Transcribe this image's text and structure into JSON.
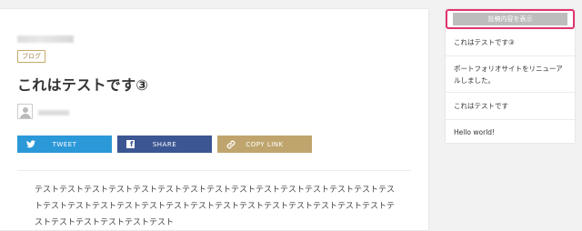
{
  "post": {
    "category": "ブログ",
    "title": "これはテストです③",
    "share": {
      "tweet_label": "TWEET",
      "share_label": "SHARE",
      "copy_label": "COPY LINK"
    },
    "body": "テストテストテストテストテストテストテストテストテストテストテストテストテストテストテストテストテストテストテストテストテストテストテストテストテストテストテストテストテストテストテストテストテストテストテスト"
  },
  "sidebar": {
    "toggle_label": "投稿内容を表示",
    "items": [
      {
        "label": "これはテストです③"
      },
      {
        "label": "ポートフォリオサイトをリニューアルしました。"
      },
      {
        "label": "これはテストです"
      },
      {
        "label": "Hello world!"
      }
    ]
  },
  "colors": {
    "tweet": "#2b98d8",
    "share": "#3b5693",
    "copy": "#bfa56d",
    "highlight": "#e0346b",
    "category": "#c6a96b"
  },
  "icons": {
    "tweet": "twitter-bird-icon",
    "share": "facebook-icon",
    "copy": "link-icon",
    "avatar": "user-avatar-icon"
  }
}
